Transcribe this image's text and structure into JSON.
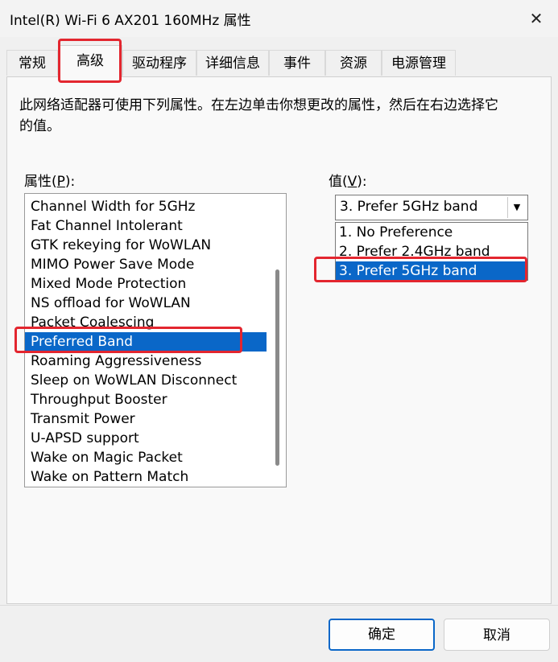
{
  "window": {
    "title": "Intel(R) Wi-Fi 6 AX201 160MHz 属性",
    "close_symbol": "✕"
  },
  "tabs": [
    {
      "label": "常规"
    },
    {
      "label": "高级"
    },
    {
      "label": "驱动程序"
    },
    {
      "label": "详细信息"
    },
    {
      "label": "事件"
    },
    {
      "label": "资源"
    },
    {
      "label": "电源管理"
    }
  ],
  "active_tab": "高级",
  "description": "此网络适配器可使用下列属性。在左边单击你想更改的属性，然后在右边选择它的值。",
  "property_label": {
    "text": "属性(",
    "mnemonic": "P",
    "suffix": "):"
  },
  "value_label": {
    "text": "值(",
    "mnemonic": "V",
    "suffix": "):"
  },
  "properties": [
    "Channel Width for 5GHz",
    "Fat Channel Intolerant",
    "GTK rekeying for WoWLAN",
    "MIMO Power Save Mode",
    "Mixed Mode Protection",
    "NS offload for WoWLAN",
    "Packet Coalescing",
    "Preferred Band",
    "Roaming Aggressiveness",
    "Sleep on WoWLAN Disconnect",
    "Throughput Booster",
    "Transmit Power",
    "U-APSD support",
    "Wake on Magic Packet",
    "Wake on Pattern Match"
  ],
  "selected_property": "Preferred Band",
  "value": {
    "current": "3. Prefer 5GHz band",
    "options": [
      "1. No Preference",
      "2. Prefer 2.4GHz band",
      "3. Prefer 5GHz band"
    ]
  },
  "buttons": {
    "ok": "确定",
    "cancel": "取消"
  },
  "colors": {
    "selection": "#0a67c8",
    "annotation": "#e3262f"
  }
}
